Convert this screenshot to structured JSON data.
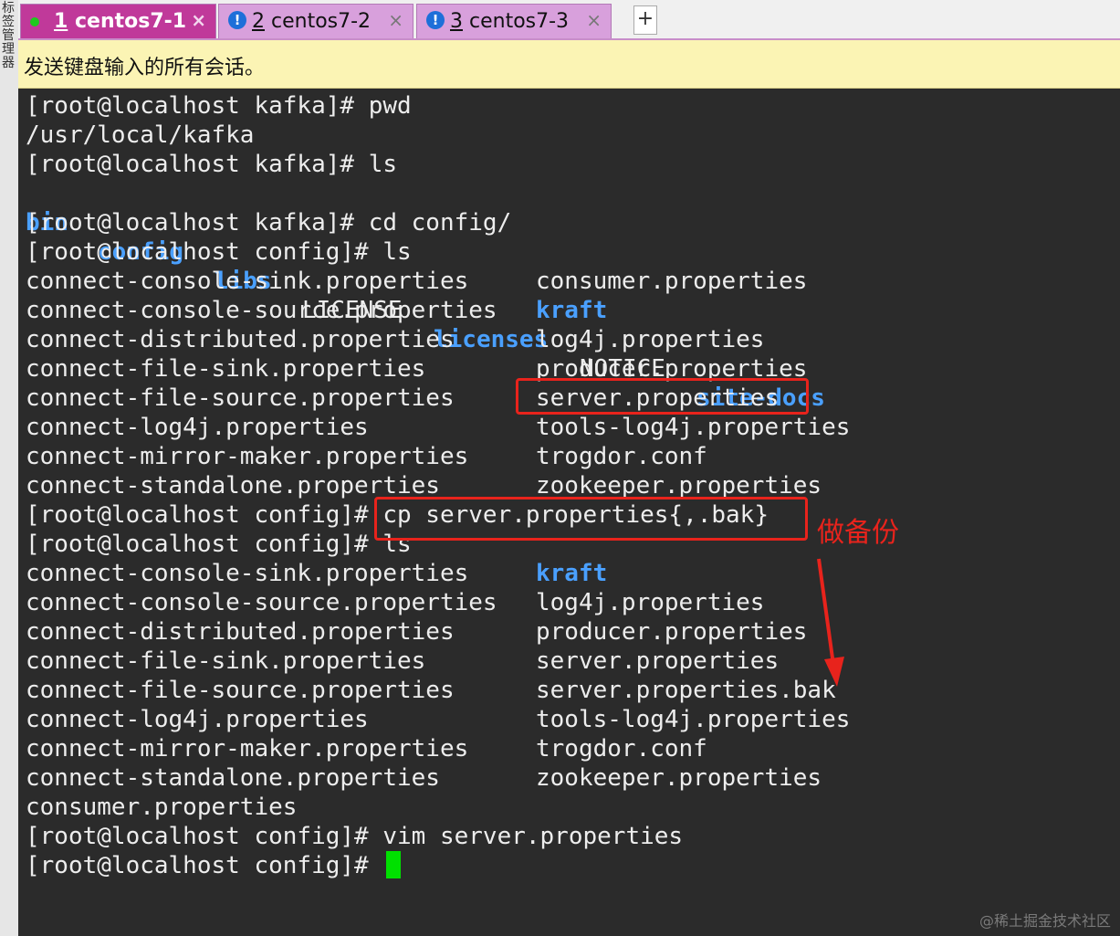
{
  "sidebar": {
    "label": "标签管理器"
  },
  "tabs": [
    {
      "number": "1",
      "title": "centos7-1",
      "status": "connected",
      "close": "×"
    },
    {
      "number": "2",
      "title": "centos7-2",
      "status": "warning",
      "status_glyph": "!",
      "close": "×"
    },
    {
      "number": "3",
      "title": "centos7-3",
      "status": "warning",
      "status_glyph": "!",
      "close": "×"
    }
  ],
  "new_tab_label": "+",
  "send_bar": {
    "text": "发送键盘输入的所有会话。"
  },
  "terminal": {
    "prompt_kafka": "[root@localhost kafka]# ",
    "prompt_config": "[root@localhost config]# ",
    "lines": {
      "l1_cmd": "pwd",
      "l2_out": "/usr/local/kafka",
      "l3_cmd": "ls",
      "ls1": [
        {
          "name": "bin",
          "type": "dir"
        },
        {
          "name": "config",
          "type": "dir"
        },
        {
          "name": "libs",
          "type": "dir"
        },
        {
          "name": "LICENSE",
          "type": "file"
        },
        {
          "name": "licenses",
          "type": "dir"
        },
        {
          "name": "NOTICE",
          "type": "file"
        },
        {
          "name": "site-docs",
          "type": "dir"
        }
      ],
      "l5_cmd": "cd config/",
      "l6_cmd": "ls",
      "listing1": {
        "left": [
          "connect-console-sink.properties",
          "connect-console-source.properties",
          "connect-distributed.properties",
          "connect-file-sink.properties",
          "connect-file-source.properties",
          "connect-log4j.properties",
          "connect-mirror-maker.properties",
          "connect-standalone.properties"
        ],
        "right": [
          {
            "name": "consumer.properties",
            "type": "file"
          },
          {
            "name": "kraft",
            "type": "dir"
          },
          {
            "name": "log4j.properties",
            "type": "file"
          },
          {
            "name": "producer.properties",
            "type": "file"
          },
          {
            "name": "server.properties",
            "type": "file"
          },
          {
            "name": "tools-log4j.properties",
            "type": "file"
          },
          {
            "name": "trogdor.conf",
            "type": "file"
          },
          {
            "name": "zookeeper.properties",
            "type": "file"
          }
        ]
      },
      "cp_cmd": "cp server.properties{,.bak}",
      "ls2_cmd": "ls",
      "listing2": {
        "left": [
          "connect-console-sink.properties",
          "connect-console-source.properties",
          "connect-distributed.properties",
          "connect-file-sink.properties",
          "connect-file-source.properties",
          "connect-log4j.properties",
          "connect-mirror-maker.properties",
          "connect-standalone.properties",
          "consumer.properties"
        ],
        "right": [
          {
            "name": "kraft",
            "type": "dir"
          },
          {
            "name": "log4j.properties",
            "type": "file"
          },
          {
            "name": "producer.properties",
            "type": "file"
          },
          {
            "name": "server.properties",
            "type": "file"
          },
          {
            "name": "server.properties.bak",
            "type": "file"
          },
          {
            "name": "tools-log4j.properties",
            "type": "file"
          },
          {
            "name": "trogdor.conf",
            "type": "file"
          },
          {
            "name": "zookeeper.properties",
            "type": "file"
          }
        ]
      },
      "vim_cmd": "vim server.properties"
    },
    "colors": {
      "background": "#2b2b2b",
      "text": "#ededed",
      "dir": "#4aa0ff",
      "cursor": "#00e000"
    }
  },
  "annotation": {
    "text": "做备份",
    "color": "#e8231c"
  },
  "watermark": "@稀土掘金技术社区"
}
